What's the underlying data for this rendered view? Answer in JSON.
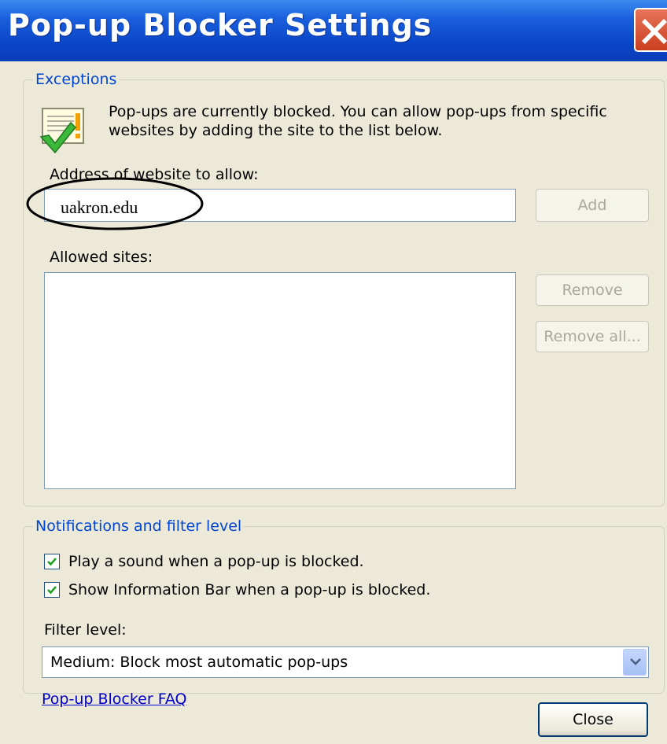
{
  "window": {
    "title": "Pop-up Blocker Settings",
    "close_icon": "close-x-icon"
  },
  "exceptions": {
    "legend": "Exceptions",
    "info_icon": "popup-allowed-check-icon",
    "info_line1": "Pop-ups are currently blocked.  You can allow pop-ups from specific",
    "info_line2": "websites by adding the site to the list below.",
    "address_label": "Address of website to allow:",
    "address_value": "uakron.edu",
    "add_label": "Add",
    "allowed_label": "Allowed sites:",
    "allowed_sites": [],
    "remove_label": "Remove",
    "remove_all_label": "Remove all..."
  },
  "notifications": {
    "legend": "Notifications and filter level",
    "play_sound_label": "Play a sound when a pop-up is blocked.",
    "play_sound_checked": true,
    "show_infobar_label": "Show Information Bar when a pop-up is blocked.",
    "show_infobar_checked": true,
    "filter_label": "Filter level:",
    "filter_value": "Medium: Block most automatic pop-ups"
  },
  "footer": {
    "faq_link": "Pop-up Blocker FAQ",
    "close_label": "Close"
  },
  "colors": {
    "title_bar": "#0a46c9",
    "dialog_bg": "#ece9d8",
    "group_legend": "#0046d5",
    "link": "#0000cc"
  }
}
